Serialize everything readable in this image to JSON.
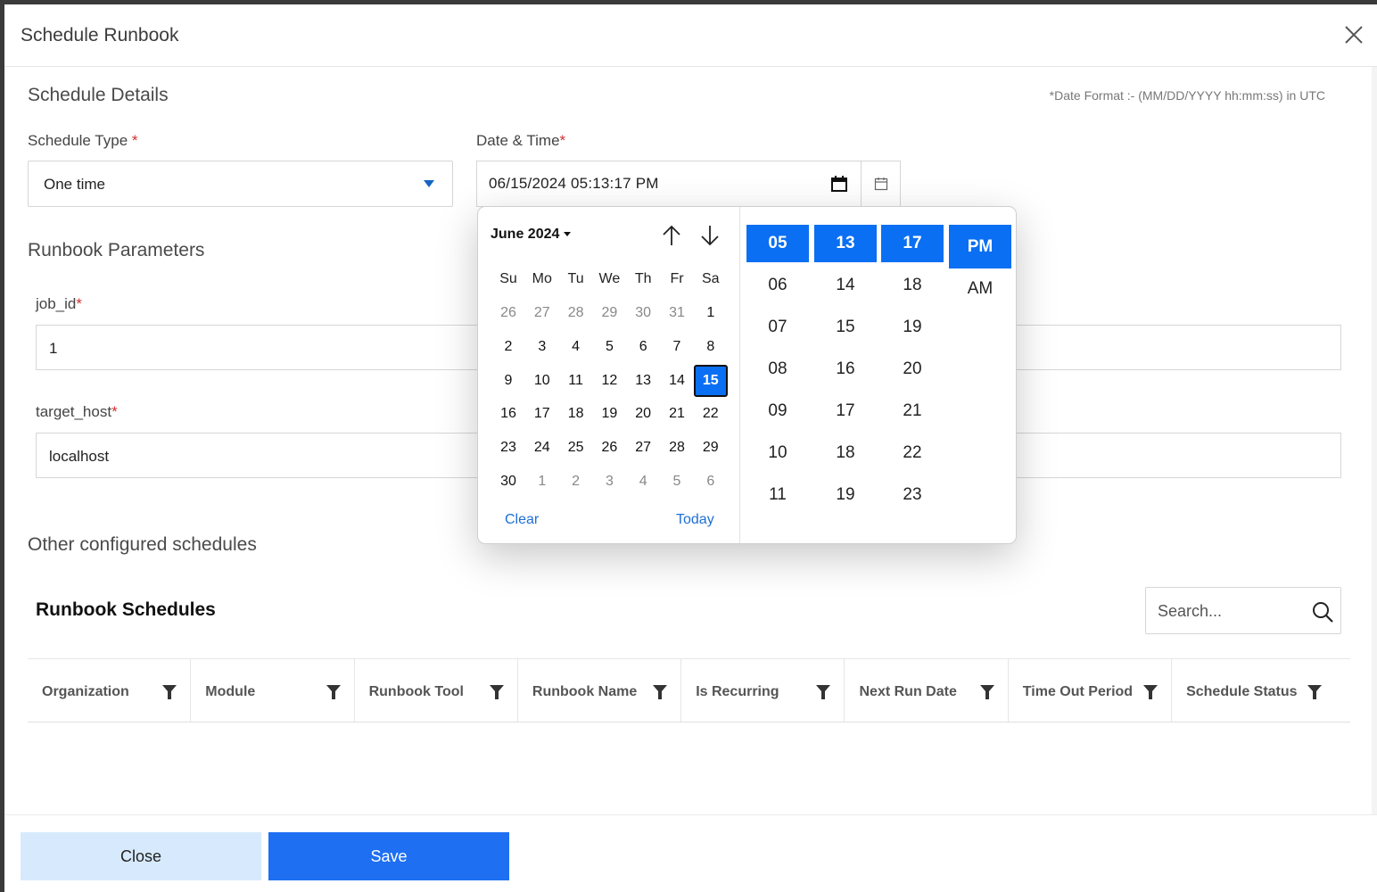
{
  "modal": {
    "title": "Schedule Runbook",
    "date_note": "*Date Format :- (MM/DD/YYYY hh:mm:ss) in UTC"
  },
  "schedule_details": {
    "title": "Schedule Details",
    "schedule_type_label": "Schedule Type",
    "schedule_type_value": "One time",
    "datetime_label": "Date & Time",
    "datetime_value": "06/15/2024 05:13:17 PM",
    "required_mark": "*"
  },
  "runbook_parameters": {
    "title": "Runbook Parameters",
    "job_id_label": "job_id",
    "job_id_value": "1",
    "target_host_label": "target_host",
    "target_host_value": "localhost"
  },
  "other_schedules": {
    "title": "Other configured schedules",
    "table_title": "Runbook Schedules",
    "search_placeholder": "Search...",
    "columns": [
      "Organization",
      "Module",
      "Runbook Tool",
      "Runbook Name",
      "Is Recurring",
      "Next Run Date",
      "Time Out Period",
      "Schedule Status"
    ]
  },
  "picker": {
    "month_label": "June 2024",
    "weekdays": [
      "Su",
      "Mo",
      "Tu",
      "We",
      "Th",
      "Fr",
      "Sa"
    ],
    "weeks": [
      [
        "26",
        "27",
        "28",
        "29",
        "30",
        "31",
        "1"
      ],
      [
        "2",
        "3",
        "4",
        "5",
        "6",
        "7",
        "8"
      ],
      [
        "9",
        "10",
        "11",
        "12",
        "13",
        "14",
        "15"
      ],
      [
        "16",
        "17",
        "18",
        "19",
        "20",
        "21",
        "22"
      ],
      [
        "23",
        "24",
        "25",
        "26",
        "27",
        "28",
        "29"
      ],
      [
        "30",
        "1",
        "2",
        "3",
        "4",
        "5",
        "6"
      ]
    ],
    "selected_day": "15",
    "clear_label": "Clear",
    "today_label": "Today",
    "hours": [
      "05",
      "06",
      "07",
      "08",
      "09",
      "10",
      "11"
    ],
    "minutes": [
      "13",
      "14",
      "15",
      "16",
      "17",
      "18",
      "19"
    ],
    "seconds": [
      "17",
      "18",
      "19",
      "20",
      "21",
      "22",
      "23"
    ],
    "pm_label": "PM",
    "am_label": "AM"
  },
  "footer": {
    "close_label": "Close",
    "save_label": "Save"
  },
  "colors": {
    "primary": "#1e6ff2",
    "selected": "#0a6ff2",
    "close_button_bg": "#d7eafd",
    "required": "#d32f2f"
  }
}
